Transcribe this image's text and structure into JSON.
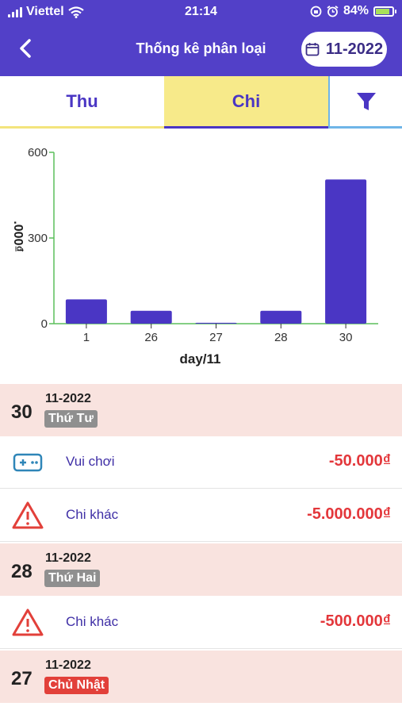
{
  "status_bar": {
    "carrier": "Viettel",
    "time": "21:14",
    "battery": "84%",
    "battery_level": 0.84
  },
  "header": {
    "title": "Thống kê phân loại",
    "month": "11-2022"
  },
  "tabs": [
    {
      "label": "Thu",
      "selected": false
    },
    {
      "label": "Chi",
      "selected": true
    }
  ],
  "icons": {
    "back": "back-arrow-icon",
    "calendar": "calendar-icon",
    "filter": "filter-icon",
    "wifi": "wifi-icon",
    "alarm": "alarm-icon",
    "lock_rotation": "rotation-lock-icon",
    "gamepad": "gamepad-icon",
    "warning": "warning-icon"
  },
  "colors": {
    "primary": "#5240c8",
    "bar": "#4a36c4",
    "axis": "#5bbf5b",
    "selected_tab": "#f7ea8a",
    "expense": "#e3373b",
    "date_bg": "#f9e3df",
    "weekday_badge": "#8f8f8f",
    "sunday_badge": "#e2403a"
  },
  "chart_data": {
    "type": "bar",
    "categories": [
      "1",
      "26",
      "27",
      "28",
      "30"
    ],
    "values": [
      85,
      45,
      3,
      45,
      505
    ],
    "ylim": [
      0,
      600
    ],
    "yticks": [
      "0",
      "300",
      "600"
    ],
    "xlabel": "day/11",
    "ylabel": ".000₫"
  },
  "groups": [
    {
      "day": "30",
      "month_year": "11-2022",
      "weekday": "Thứ Tư",
      "items": [
        {
          "category": "Vui chơi",
          "amount": "-50.000₫"
        },
        {
          "category": "Chi khác",
          "amount": "-5.000.000₫"
        }
      ]
    },
    {
      "day": "28",
      "month_year": "11-2022",
      "weekday": "Thứ Hai",
      "items": [
        {
          "category": "Chi khác",
          "amount": "-500.000₫"
        }
      ]
    },
    {
      "day": "27",
      "month_year": "11-2022",
      "weekday": "Chủ Nhật",
      "items": []
    }
  ]
}
